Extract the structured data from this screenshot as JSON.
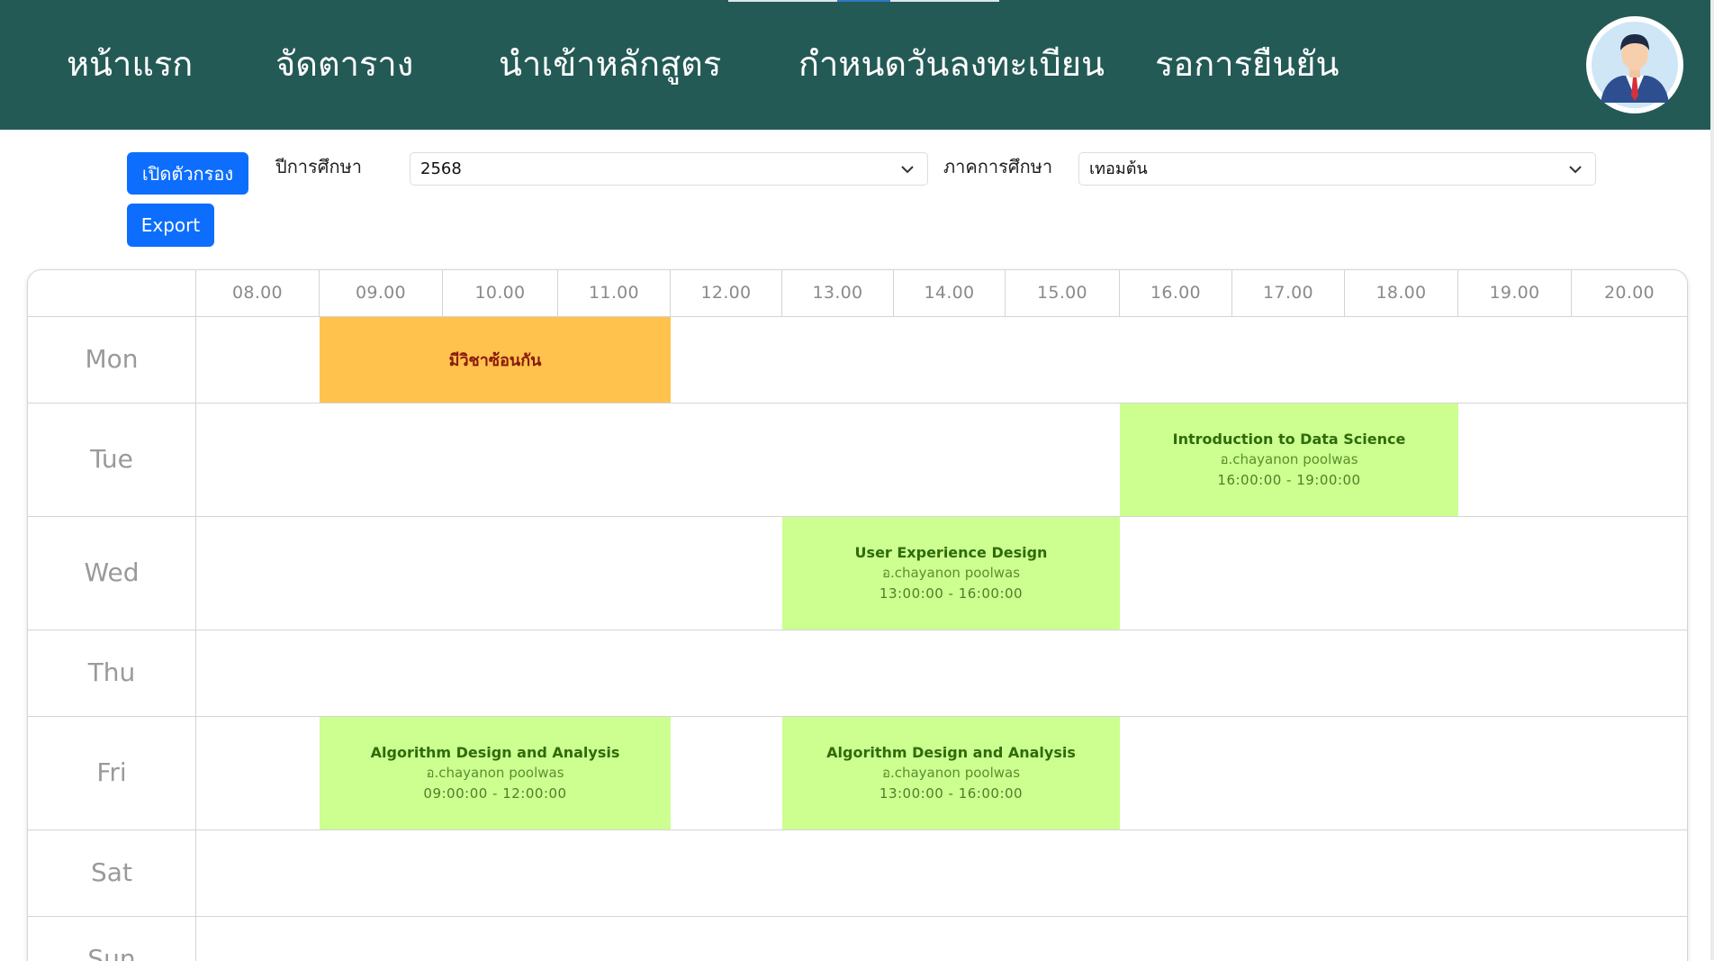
{
  "nav": {
    "home": "หน้าแรก",
    "schedule": "จัดตาราง",
    "import_curriculum": "นำเข้าหลักสูตร",
    "registration_dates": "กำหนดวันลงทะเบียน",
    "pending": "รอการยืนยัน",
    "avatar_icon": "user-avatar-icon"
  },
  "filters": {
    "open_filter_label": "เปิดตัวกรอง",
    "export_label": "Export",
    "year_label": "ปีการศึกษา",
    "year_value": "2568",
    "term_label": "ภาคการศึกษา",
    "term_value": "เทอมต้น"
  },
  "timetable": {
    "hours": [
      "08.00",
      "09.00",
      "10.00",
      "11.00",
      "12.00",
      "13.00",
      "14.00",
      "15.00",
      "16.00",
      "17.00",
      "18.00",
      "19.00",
      "20.00"
    ],
    "days": [
      "Mon",
      "Tue",
      "Wed",
      "Thu",
      "Fri",
      "Sat",
      "Sun"
    ],
    "events": [
      {
        "day": "Mon",
        "start": "09:00:00",
        "end": "12:00:00",
        "type": "conflict",
        "label": "มีวิชาซ้อนกัน"
      },
      {
        "day": "Tue",
        "start": "16:00:00",
        "end": "19:00:00",
        "type": "course",
        "title": "Introduction to Data Science",
        "teacher": "อ.chayanon poolwas",
        "time": "16:00:00 - 19:00:00"
      },
      {
        "day": "Wed",
        "start": "13:00:00",
        "end": "16:00:00",
        "type": "course",
        "title": "User Experience Design",
        "teacher": "อ.chayanon poolwas",
        "time": "13:00:00 - 16:00:00"
      },
      {
        "day": "Fri",
        "start": "09:00:00",
        "end": "12:00:00",
        "type": "course",
        "title": "Algorithm Design and Analysis",
        "teacher": "อ.chayanon poolwas",
        "time": "09:00:00 - 12:00:00"
      },
      {
        "day": "Fri",
        "start": "13:00:00",
        "end": "16:00:00",
        "type": "course",
        "title": "Algorithm Design and Analysis",
        "teacher": "อ.chayanon poolwas",
        "time": "13:00:00 - 16:00:00"
      }
    ]
  },
  "colors": {
    "navbar": "#245a55",
    "primary_button": "#0d6efd",
    "course_block": "#ccff90",
    "conflict_block": "#ffc34d"
  }
}
